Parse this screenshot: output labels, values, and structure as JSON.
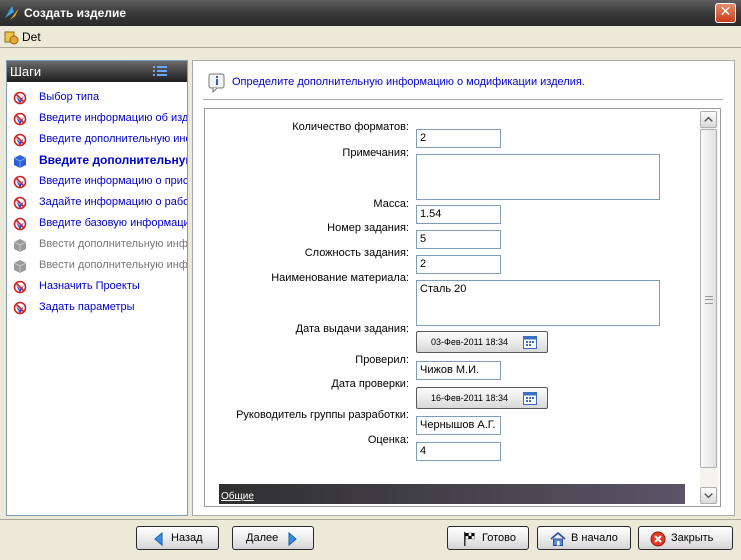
{
  "window": {
    "title": "Создать изделие",
    "close_symbol": "✕"
  },
  "object": {
    "name": "Det"
  },
  "sidebar": {
    "header": "Шаги",
    "steps": [
      {
        "label": "Выбор типа",
        "state": "done"
      },
      {
        "label": "Введите информацию об изделии",
        "state": "done"
      },
      {
        "label": "Введите дополнительную информацию",
        "state": "done"
      },
      {
        "label": "Введите дополнительную информацию",
        "state": "active"
      },
      {
        "label": "Введите информацию о присоединении",
        "state": "done"
      },
      {
        "label": "Задайте информацию о рабочем",
        "state": "done"
      },
      {
        "label": "Введите базовую информацию",
        "state": "done"
      },
      {
        "label": "Ввести дополнительную информацию",
        "state": "disabled"
      },
      {
        "label": "Ввести дополнительную информацию",
        "state": "disabled"
      },
      {
        "label": "Назначить Проекты",
        "state": "done"
      },
      {
        "label": "Задать параметры",
        "state": "done"
      }
    ]
  },
  "main": {
    "info_text": "Определите дополнительную информацию о модификации изделия.",
    "fields": {
      "formats_count": {
        "label": "Количество форматов:",
        "value": "2"
      },
      "notes": {
        "label": "Примечания:",
        "value": ""
      },
      "mass": {
        "label": "Масса:",
        "value": "1.54"
      },
      "task_number": {
        "label": "Номер задания:",
        "value": "5"
      },
      "task_complexity": {
        "label": "Сложность задания:",
        "value": "2"
      },
      "material_name": {
        "label": "Наименование материала:",
        "value": "Сталь 20"
      },
      "task_issue_date": {
        "label": "Дата выдачи задания:",
        "value": "03-Фев-2011 18:34"
      },
      "checked_by": {
        "label": "Проверил:",
        "value": "Чижов М.И."
      },
      "check_date": {
        "label": "Дата проверки:",
        "value": "16-Фев-2011 18:34"
      },
      "group_leader": {
        "label": "Руководитель группы разработки:",
        "value": "Чернышов А.Г."
      },
      "rating": {
        "label": "Оценка:",
        "value": "4"
      }
    },
    "tab": "Общие"
  },
  "buttons": {
    "back": "Назад",
    "next": "Далее",
    "finish": "Готово",
    "home": "В начало",
    "close": "Закрыть"
  },
  "colors": {
    "link": "#0000cc",
    "titlebar": "#3a3a3a",
    "frame": "#ece9d8"
  },
  "icons": [
    "app-logo-icon",
    "part-icon",
    "list-icon",
    "step-check-icon",
    "step-active-cube-icon",
    "step-disabled-cube-icon",
    "info-icon",
    "calendar-icon",
    "arrow-left-icon",
    "arrow-right-icon",
    "checkered-flag-icon",
    "home-icon",
    "close-circle-icon"
  ]
}
